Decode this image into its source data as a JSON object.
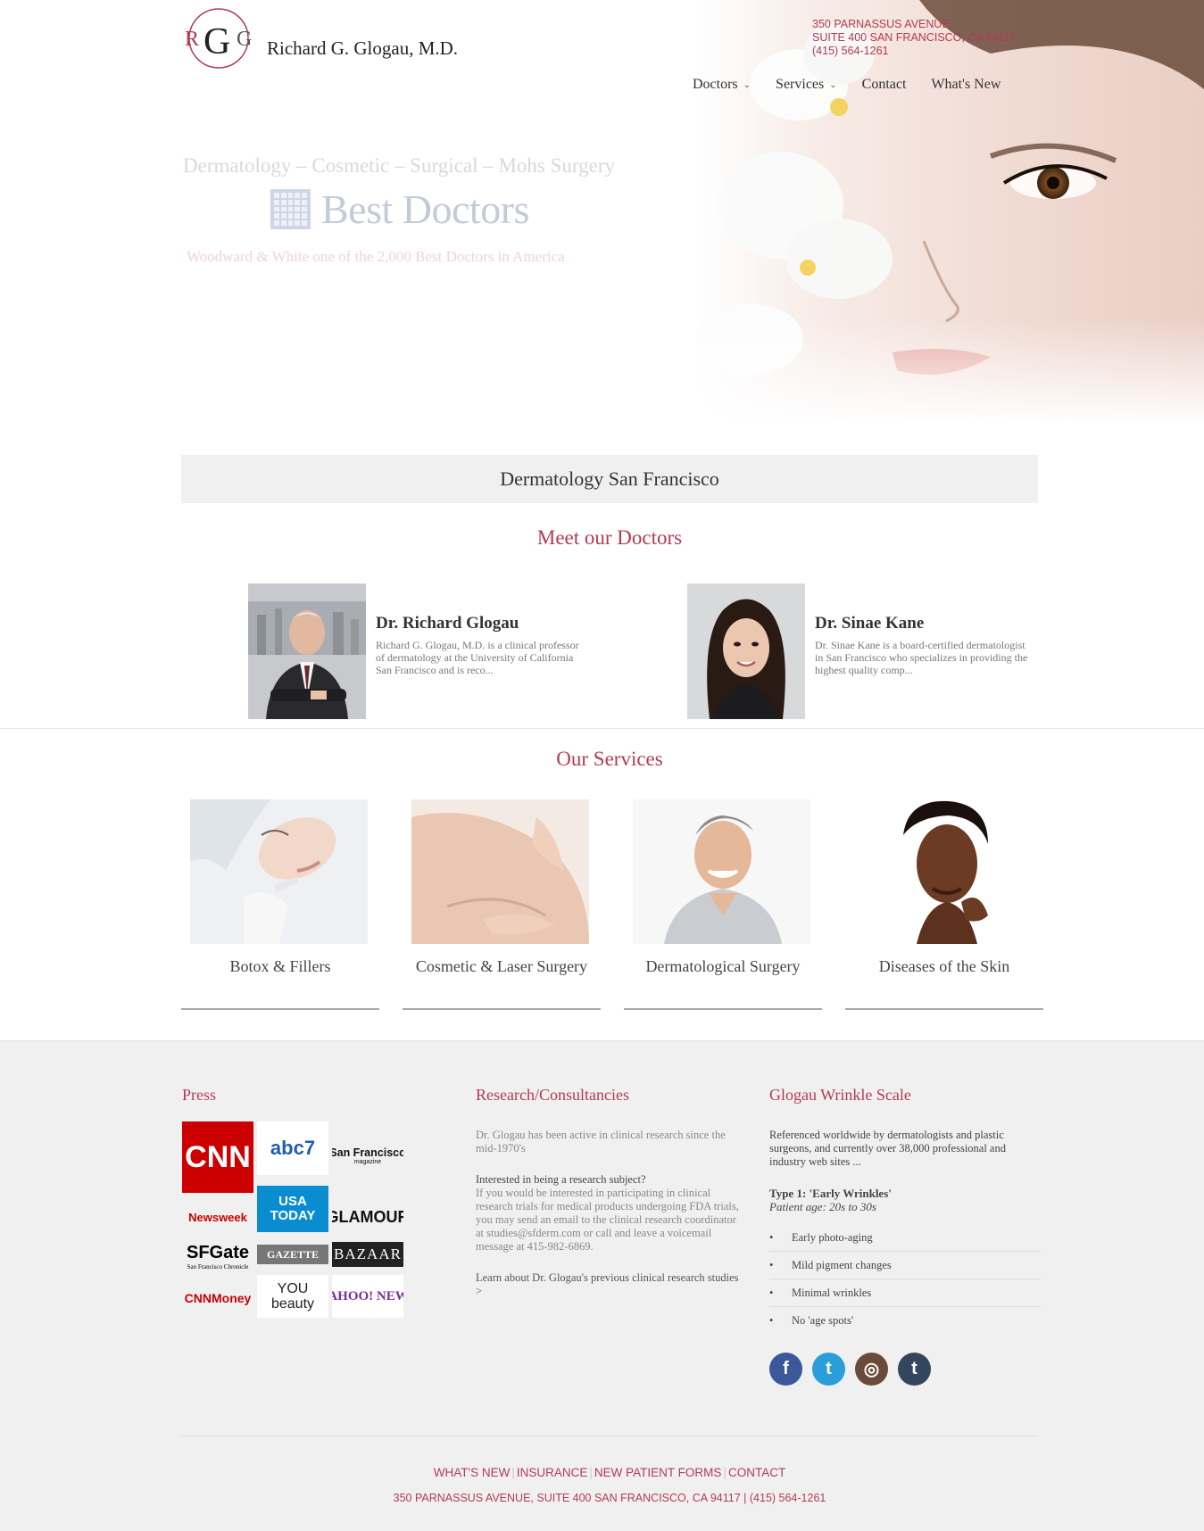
{
  "brand": {
    "monogram": [
      "R",
      "G",
      "G"
    ],
    "name": "Richard G. Glogau, M.D."
  },
  "address": {
    "line1": "350 PARNASSUS AVENUE,",
    "line2": "SUITE 400 SAN FRANCISCO, CA 94117",
    "phone": "(415) 564-1261"
  },
  "nav": {
    "items": [
      {
        "label": "Doctors",
        "has_menu": true
      },
      {
        "label": "Services",
        "has_menu": true
      },
      {
        "label": "Contact",
        "has_menu": false
      },
      {
        "label": "What's New",
        "has_menu": false
      }
    ]
  },
  "hero": {
    "tagline": "Dermatology – Cosmetic – Surgical – Mohs Surgery",
    "badge_text": "Best Doctors",
    "badge_caption": "Woodward & White one of the 2,000 Best Doctors in America"
  },
  "intro": {
    "title": "Dermatology San Francisco"
  },
  "doctors": {
    "title": "Meet our Doctors",
    "items": [
      {
        "name": "Dr. Richard Glogau",
        "bio": "Richard G. Glogau, M.D. is a clinical professor of dermatology at the University of California San Francisco and is reco..."
      },
      {
        "name": "Dr. Sinae Kane",
        "bio": "Dr. Sinae Kane is a board-certified dermatologist in San Francisco who specializes in providing the highest quality comp..."
      }
    ]
  },
  "services": {
    "title": "Our Services",
    "items": [
      {
        "label": "Botox & Fillers"
      },
      {
        "label": "Cosmetic & Laser Surgery"
      },
      {
        "label": "Dermatological Surgery"
      },
      {
        "label": "Diseases of the Skin"
      }
    ]
  },
  "press": {
    "title": "Press",
    "logos": [
      "CNN",
      "abc7",
      "San Francisco",
      "Newsweek",
      "USA TODAY",
      "GLAMOUR",
      "SFGate",
      "GAZETTE",
      "BAZAAR",
      "CNNMoney",
      "YOU beauty",
      "YAHOO! NEWS"
    ],
    "logo_subtexts": [
      "magazine",
      "San Francisco Chronicle",
      "NEWS"
    ]
  },
  "research": {
    "title": "Research/Consultancies",
    "intro": "Dr. Glogau has been active in clinical research since the mid-1970's",
    "subject_heading": "Interested in being a research subject?",
    "subject_body": "If you would be interested in participating in clinical research trials for medical products undergoing FDA trials, you may send an email to the clinical research coordinator at studies@sfderm.com or call and leave a voicemail message at 415-982-6869.",
    "link": "Learn about Dr. Glogau's previous clinical research studies >"
  },
  "wrinkle": {
    "title": "Glogau Wrinkle Scale",
    "intro": "Referenced worldwide by dermatologists and plastic surgeons, and currently over 38,000 professional and industry web sites ...",
    "type": "Type 1: 'Early Wrinkles'",
    "age": "Patient age: 20s to 30s",
    "bullets": [
      "Early photo-aging",
      "Mild pigment changes",
      "Minimal wrinkles",
      "No 'age spots'"
    ]
  },
  "social": [
    {
      "icon": "facebook-icon",
      "glyph": "f",
      "color": "#3b5998"
    },
    {
      "icon": "twitter-icon",
      "glyph": "t",
      "color": "#2a9ed8"
    },
    {
      "icon": "instagram-icon",
      "glyph": "◎",
      "color": "#6a4b3a"
    },
    {
      "icon": "tumblr-icon",
      "glyph": "t",
      "color": "#34465d"
    }
  ],
  "footer": {
    "links": [
      "WHAT'S NEW",
      "INSURANCE",
      "NEW PATIENT FORMS",
      "CONTACT"
    ],
    "address": "350 PARNASSUS AVENUE, SUITE 400 SAN FRANCISCO, CA 94117 | (415) 564-1261"
  },
  "colors": {
    "accent": "#b13b54",
    "nav_text": "#333333",
    "intro_bar": "#f1f0f1",
    "footer_bg": "#f0f0f1"
  }
}
